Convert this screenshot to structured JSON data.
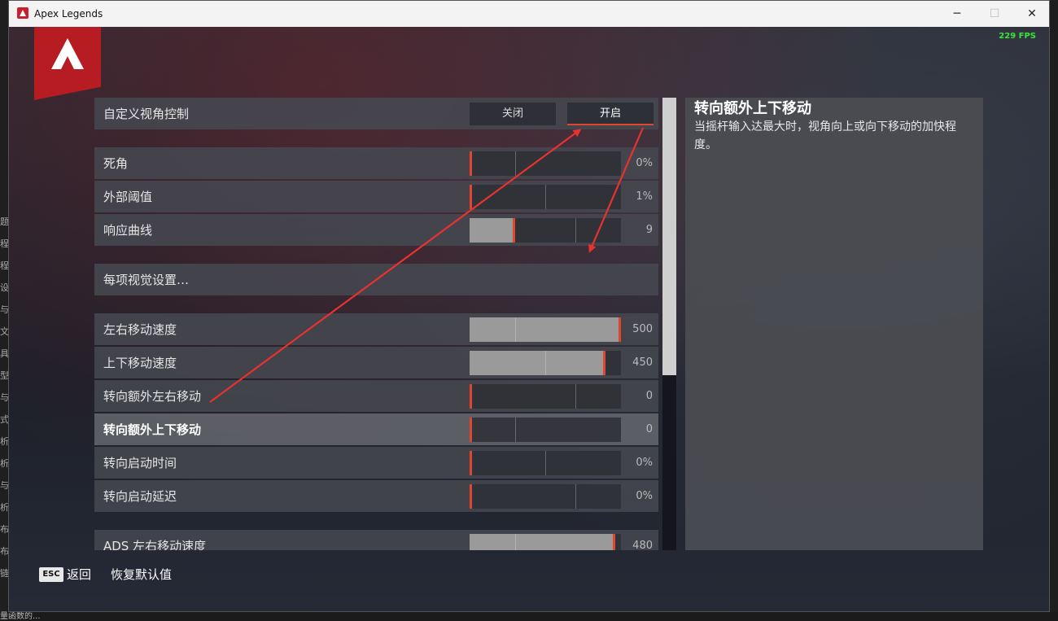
{
  "window": {
    "title": "Apex Legends",
    "minimize": "─",
    "maximize": "☐",
    "close": "✕"
  },
  "fps": "229 FPS",
  "custom_look": {
    "label": "自定义视角控制",
    "off": "关闭",
    "on": "开启",
    "selected": "on"
  },
  "group1": [
    {
      "label": "死角",
      "value": "0%",
      "level": 0
    },
    {
      "label": "外部阈值",
      "value": "1%",
      "level": 0.01
    },
    {
      "label": "响应曲线",
      "value": "9",
      "level": 0.3
    }
  ],
  "per_optic": {
    "label": "每项视觉设置…"
  },
  "group2": [
    {
      "label": "左右移动速度",
      "value": "500",
      "level": 1.0
    },
    {
      "label": "上下移动速度",
      "value": "450",
      "level": 0.9
    },
    {
      "label": "转向额外左右移动",
      "value": "0",
      "level": 0
    },
    {
      "label": "转向额外上下移动",
      "value": "0",
      "level": 0,
      "selected": true
    },
    {
      "label": "转向启动时间",
      "value": "0%",
      "level": 0
    },
    {
      "label": "转向启动延迟",
      "value": "0%",
      "level": 0
    }
  ],
  "group3": [
    {
      "label": "ADS 左右移动速度",
      "value": "480",
      "level": 0.96
    }
  ],
  "description": {
    "title": "转向额外上下移动",
    "text": "当摇杆输入达最大时，视角向上或向下移动的加快程度。"
  },
  "footer": {
    "esc": "ESC",
    "back": "返回",
    "reset": "恢复默认值"
  },
  "desktop": {
    "left_chars": [
      "题",
      "程",
      "程",
      "设",
      "与",
      "文",
      "具",
      "型",
      "与",
      "式",
      "析",
      "析",
      "与",
      "析",
      "布",
      "布",
      "链"
    ],
    "bottom_text": "量函数的..."
  },
  "colors": {
    "accent": "#e0462e",
    "brand": "#b71c23",
    "fps": "#37e53a"
  }
}
